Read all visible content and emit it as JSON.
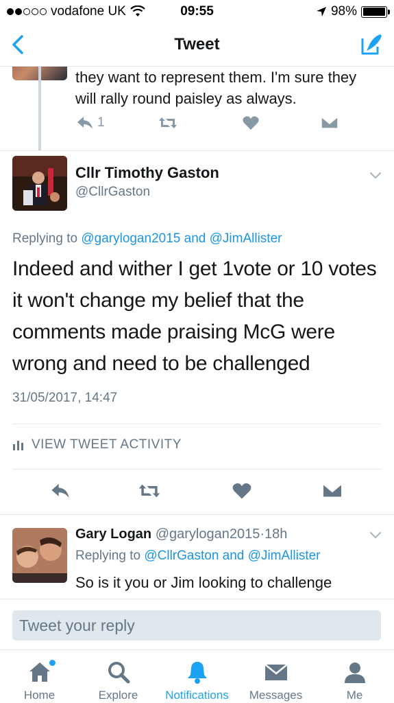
{
  "status_bar": {
    "carrier": "vodafone UK",
    "time": "09:55",
    "battery": "98%",
    "battery_level": 0.98
  },
  "nav": {
    "title": "Tweet"
  },
  "previous_tweet": {
    "text": "they want to represent them. I'm sure they will rally round paisley as always.",
    "reply_count": "1"
  },
  "main_tweet": {
    "name": "Cllr Timothy Gaston",
    "handle": "@CllrGaston",
    "replying_label": "Replying to",
    "replying_user1": "@garylogan2015",
    "replying_and": "and",
    "replying_user2": "@JimAllister",
    "text": "Indeed and wither I get 1vote or 10 votes it won't change my belief that the comments made praising McG were wrong and need to be challenged",
    "timestamp": "31/05/2017, 14:47",
    "activity_label": "VIEW TWEET ACTIVITY"
  },
  "reply_tweet": {
    "name": "Gary Logan",
    "handle": "@garylogan2015",
    "separator": "·",
    "time": "18h",
    "replying_label": "Replying to",
    "replying_user1": "@CllrGaston",
    "replying_and": "and",
    "replying_user2": "@JimAllister",
    "text": "So is it you or Jim looking to challenge"
  },
  "composer": {
    "placeholder": "Tweet your reply"
  },
  "tabs": [
    {
      "label": "Home",
      "icon": "home-icon"
    },
    {
      "label": "Explore",
      "icon": "search-icon"
    },
    {
      "label": "Notifications",
      "icon": "bell-icon"
    },
    {
      "label": "Messages",
      "icon": "envelope-icon"
    },
    {
      "label": "Me",
      "icon": "person-icon"
    }
  ],
  "colors": {
    "accent": "#1da1f2",
    "link": "#1b95e0",
    "muted": "#657786",
    "icon_gray": "#8899a6"
  }
}
